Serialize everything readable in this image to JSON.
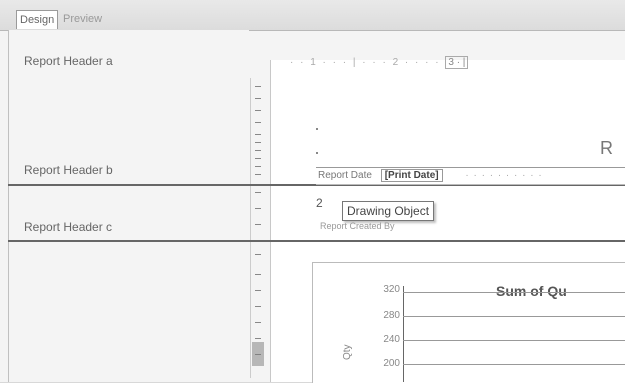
{
  "tabs": [
    {
      "label": "Design",
      "active": true
    },
    {
      "label": "Preview",
      "active": false
    }
  ],
  "sections": [
    {
      "label": "Report Header a"
    },
    {
      "label": "Report Header b"
    },
    {
      "label": "Report Header c"
    }
  ],
  "ruler": {
    "text": "· · 1 · · · | · · · 2 · · · ·",
    "zoom": "3 · |"
  },
  "report": {
    "title_fragment": "R",
    "field_label": "Report Date",
    "field_value": "[Print Date]",
    "field_trailing": "· · · · · · · · · ·",
    "marker": "2",
    "tooltip": "Drawing Object",
    "under_label": "Report Created By"
  },
  "chart": {
    "title": "Sum of Qu",
    "y_label": "Qty",
    "ticks": [
      "320",
      "280",
      "240",
      "200"
    ]
  },
  "chart_data": {
    "type": "bar",
    "title": "Sum of Qu",
    "ylabel": "Qty",
    "yticks": [
      320,
      280,
      240,
      200
    ],
    "categories": [],
    "values": []
  }
}
